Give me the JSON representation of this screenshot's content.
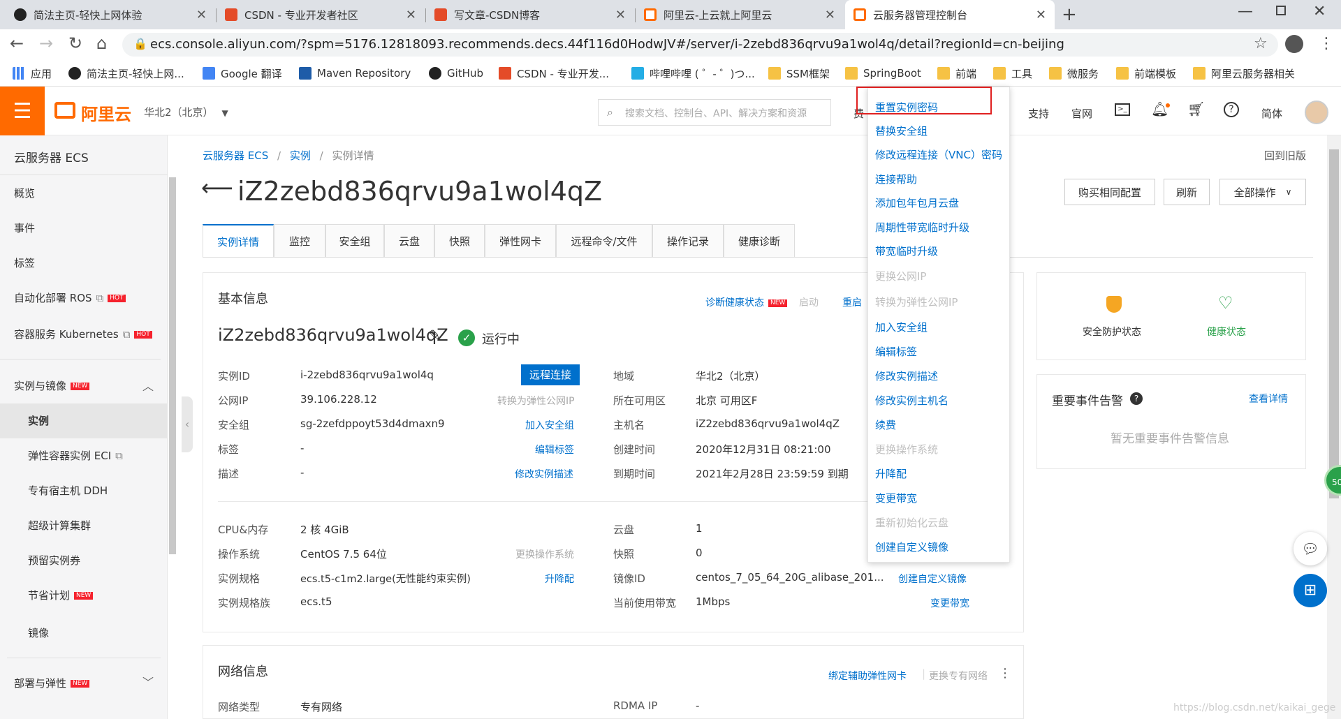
{
  "browser": {
    "tabs": [
      {
        "title": "简法主页-轻快上网体验",
        "fav_color": "#222222"
      },
      {
        "title": "CSDN - 专业开发者社区",
        "fav_color": "#e44b28"
      },
      {
        "title": "写文章-CSDN博客",
        "fav_color": "#e44b28"
      },
      {
        "title": "阿里云-上云就上阿里云",
        "fav_color": "#ff6a00"
      },
      {
        "title": "云服务器管理控制台",
        "fav_color": "#ff6a00"
      }
    ],
    "url": "ecs.console.aliyun.com/?spm=5176.12818093.recommends.decs.44f116d0HodwJV#/server/i-2zebd836qrvu9a1wol4q/detail?regionId=cn-beijing",
    "bookmarks": [
      {
        "label": "应用",
        "icon": "apps-icon"
      },
      {
        "label": "简法主页-轻快上网...",
        "icon": "jianfa-icon"
      },
      {
        "label": "Google 翻译",
        "icon": "translate-icon"
      },
      {
        "label": "Maven Repository",
        "icon": "maven-icon"
      },
      {
        "label": "GitHub",
        "icon": "github-icon"
      },
      {
        "label": "CSDN - 专业开发...",
        "icon": "csdn-icon"
      },
      {
        "label": "哔哩哔哩 ( ゜- ゜)つ...",
        "icon": "bilibili-icon"
      },
      {
        "label": "SSM框架",
        "icon": "folder-icon"
      },
      {
        "label": "SpringBoot",
        "icon": "folder-icon"
      },
      {
        "label": "前端",
        "icon": "folder-icon"
      },
      {
        "label": "工具",
        "icon": "folder-icon"
      },
      {
        "label": "微服务",
        "icon": "folder-icon"
      },
      {
        "label": "前端模板",
        "icon": "folder-icon"
      },
      {
        "label": "阿里云服务器相关",
        "icon": "folder-icon"
      }
    ]
  },
  "console": {
    "logo": "阿里云",
    "region": "华北2（北京）",
    "search_placeholder": "搜索文档、控制台、API、解决方案和资源",
    "header_partial": "费",
    "header_links": [
      "支持",
      "官网",
      "简体"
    ]
  },
  "sidebar": {
    "title": "云服务器 ECS",
    "items": [
      {
        "label": "概览"
      },
      {
        "label": "事件"
      },
      {
        "label": "标签"
      },
      {
        "label": "自动化部署 ROS",
        "badge": "HOT"
      },
      {
        "label": "容器服务 Kubernetes",
        "badge": "HOT"
      },
      {
        "label": "实例与镜像",
        "badge": "NEW"
      },
      {
        "label": "实例"
      },
      {
        "label": "弹性容器实例 ECI"
      },
      {
        "label": "专有宿主机 DDH"
      },
      {
        "label": "超级计算集群"
      },
      {
        "label": "预留实例券"
      },
      {
        "label": "节省计划",
        "badge": "NEW"
      },
      {
        "label": "镜像"
      },
      {
        "label": "部署与弹性",
        "badge": "NEW"
      }
    ]
  },
  "breadcrumb": [
    "云服务器 ECS",
    "实例",
    "实例详情"
  ],
  "back_old": "回到旧版",
  "page_title": "iZ2zebd836qrvu9a1wol4qZ",
  "actions": {
    "buy_same": "购买相同配置",
    "refresh": "刷新",
    "all_ops": "全部操作"
  },
  "detail_tabs": [
    "实例详情",
    "监控",
    "安全组",
    "云盘",
    "快照",
    "弹性网卡",
    "远程命令/文件",
    "操作记录",
    "健康诊断"
  ],
  "basic": {
    "section_title": "基本信息",
    "diagnose": "诊断健康状态",
    "diagnose_badge": "NEW",
    "start": "启动",
    "restart": "重启",
    "name": "iZ2zebd836qrvu9a1wol4qZ",
    "status": "运行中",
    "remote_btn": "远程连接",
    "left_rows": [
      {
        "label": "实例ID",
        "value": "i-2zebd836qrvu9a1wol4q",
        "action": "",
        "action_disabled": false
      },
      {
        "label": "公网IP",
        "value": "39.106.228.12",
        "action": "转换为弹性公网IP",
        "action_disabled": true
      },
      {
        "label": "安全组",
        "value": "sg-2zefdppoyt53d4dmaxn9",
        "action": "加入安全组",
        "action_disabled": false
      },
      {
        "label": "标签",
        "value": "-",
        "action": "编辑标签",
        "action_disabled": false
      },
      {
        "label": "描述",
        "value": "-",
        "action": "修改实例描述",
        "action_disabled": false
      }
    ],
    "right_rows": [
      {
        "label": "地域",
        "value": "华北2（北京）"
      },
      {
        "label": "所在可用区",
        "value": "北京 可用区F"
      },
      {
        "label": "主机名",
        "value": "iZ2zebd836qrvu9a1wol4qZ"
      },
      {
        "label": "创建时间",
        "value": "2020年12月31日 08:21:00"
      },
      {
        "label": "到期时间",
        "value": "2021年2月28日 23:59:59 到期"
      }
    ],
    "config_left": [
      {
        "label": "CPU&内存",
        "value": "2 核 4GiB",
        "action": "",
        "action_disabled": false
      },
      {
        "label": "操作系统",
        "value": "CentOS 7.5 64位",
        "action": "更换操作系统",
        "action_disabled": true
      },
      {
        "label": "实例规格",
        "value": "ecs.t5-c1m2.large(无性能约束实例)",
        "action": "升降配",
        "action_disabled": false
      },
      {
        "label": "实例规格族",
        "value": "ecs.t5",
        "action": "",
        "action_disabled": false
      }
    ],
    "config_right": [
      {
        "label": "云盘",
        "value": "1",
        "action": ""
      },
      {
        "label": "快照",
        "value": "0",
        "action": ""
      },
      {
        "label": "镜像ID",
        "value": "centos_7_05_64_20G_alibase_201...",
        "action": "创建自定义镜像"
      },
      {
        "label": "当前使用带宽",
        "value": "1Mbps",
        "action": "变更带宽"
      }
    ]
  },
  "network": {
    "section_title": "网络信息",
    "bind_eni": "绑定辅助弹性网卡",
    "change_vpc": "更换专有网络",
    "row_label1": "网络类型",
    "row_value1": "专有网络",
    "row_label2": "RDMA IP",
    "row_value2": "-"
  },
  "status_card": {
    "security": "安全防护状态",
    "health": "健康状态"
  },
  "events_card": {
    "title": "重要事件告警",
    "link": "查看详情",
    "empty": "暂无重要事件告警信息"
  },
  "float_badge": "50",
  "dropdown": [
    {
      "label": "重置实例密码",
      "disabled": false
    },
    {
      "label": "替换安全组",
      "disabled": false
    },
    {
      "label": "修改远程连接（VNC）密码",
      "disabled": false
    },
    {
      "label": "连接帮助",
      "disabled": false
    },
    {
      "label": "添加包年包月云盘",
      "disabled": false
    },
    {
      "label": "周期性带宽临时升级",
      "disabled": false
    },
    {
      "label": "带宽临时升级",
      "disabled": false
    },
    {
      "label": "更换公网IP",
      "disabled": true
    },
    {
      "label": "转换为弹性公网IP",
      "disabled": true
    },
    {
      "label": "加入安全组",
      "disabled": false
    },
    {
      "label": "编辑标签",
      "disabled": false
    },
    {
      "label": "修改实例描述",
      "disabled": false
    },
    {
      "label": "修改实例主机名",
      "disabled": false
    },
    {
      "label": "续费",
      "disabled": false
    },
    {
      "label": "更换操作系统",
      "disabled": true
    },
    {
      "label": "升降配",
      "disabled": false
    },
    {
      "label": "变更带宽",
      "disabled": false
    },
    {
      "label": "重新初始化云盘",
      "disabled": true
    },
    {
      "label": "创建自定义镜像",
      "disabled": false
    }
  ],
  "watermark": "https://blog.csdn.net/kaikai_gege",
  "colors": {
    "accent": "#ff6a00",
    "link": "#0070cc",
    "highlight": "#e02020",
    "success": "#2aa14a"
  }
}
